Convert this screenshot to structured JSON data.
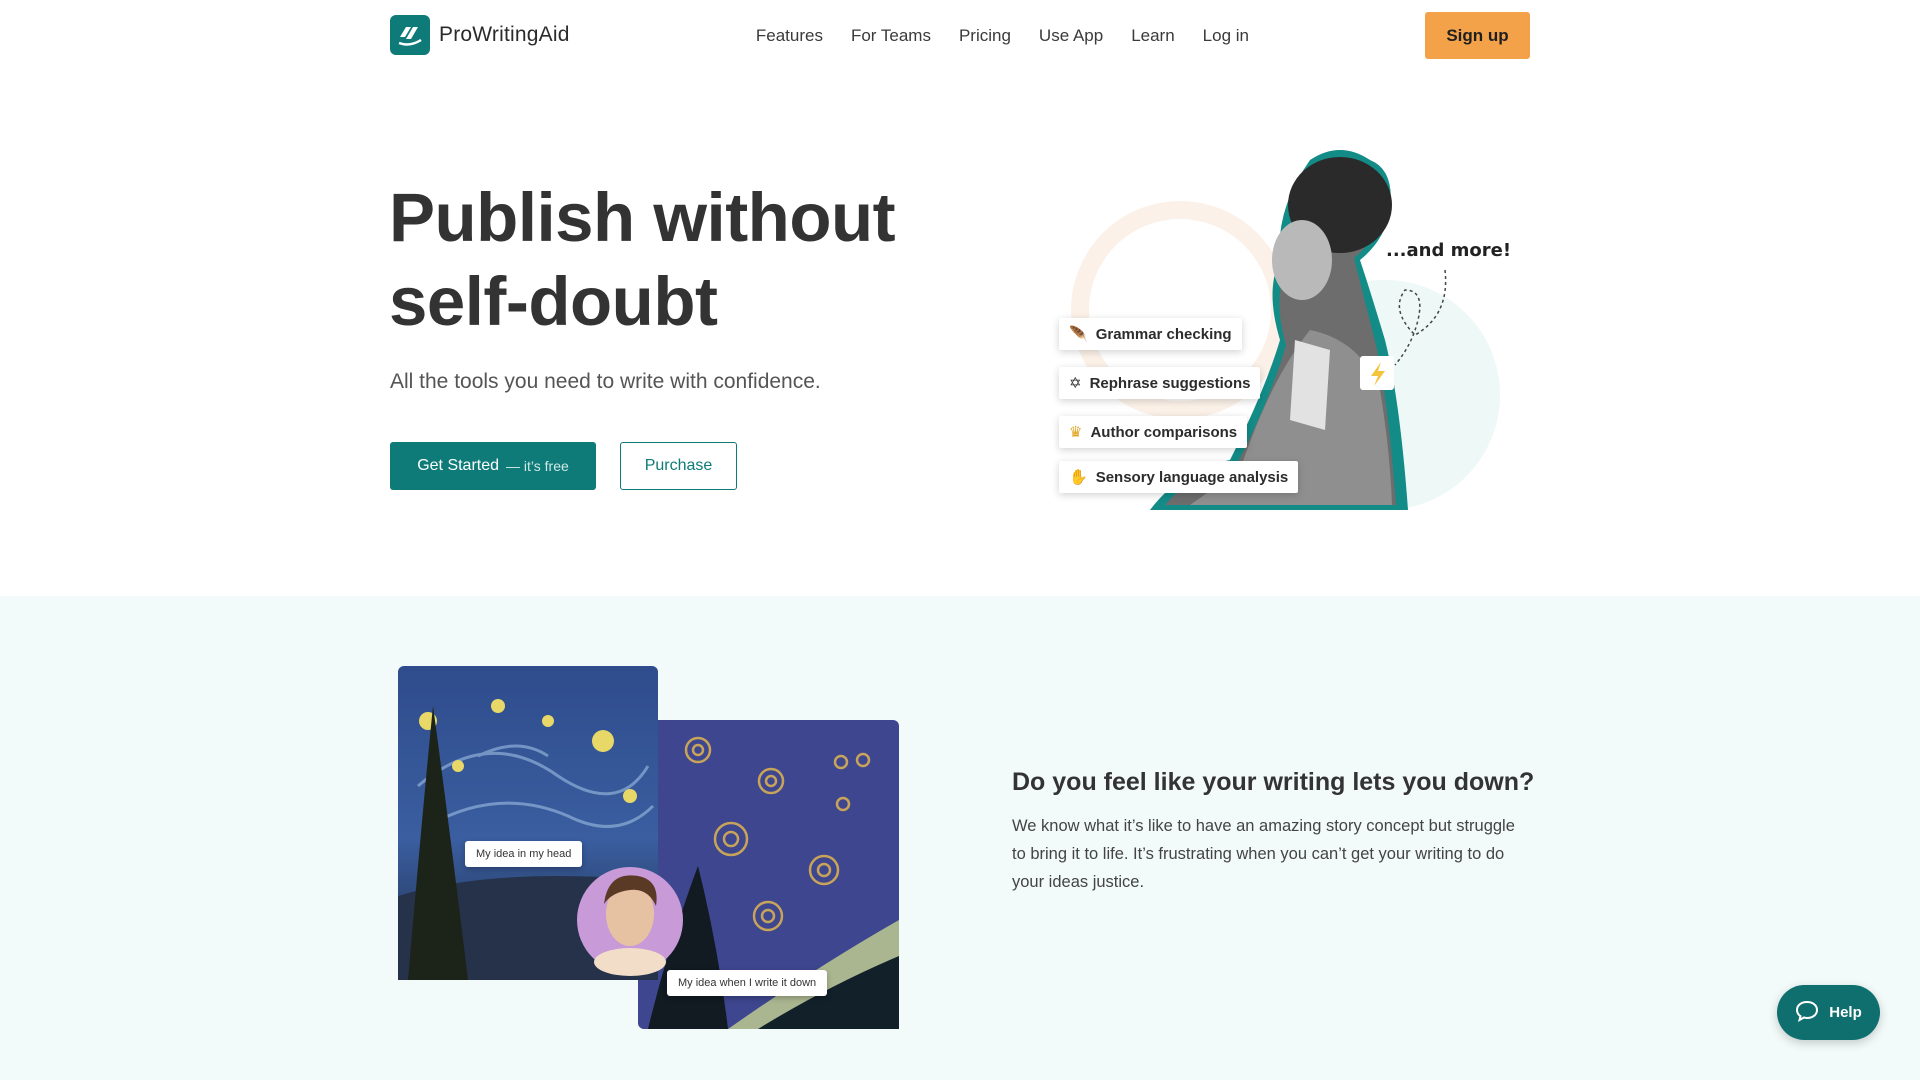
{
  "brand": {
    "name": "ProWritingAid",
    "accent": "#0e7b78",
    "signup_color": "#f4a249"
  },
  "nav": {
    "links": [
      "Features",
      "For Teams",
      "Pricing",
      "Use App",
      "Learn",
      "Log in"
    ],
    "signup": "Sign up"
  },
  "hero": {
    "title": "Publish without self-doubt",
    "subtitle": "All the tools you need to write with confidence.",
    "primary_button": {
      "label": "Get Started",
      "aside": "— it’s free"
    },
    "secondary_button": "Purchase",
    "features": [
      {
        "label": "Grammar checking",
        "icon": "feather-icon"
      },
      {
        "label": "Rephrase suggestions",
        "icon": "magic-wand-icon"
      },
      {
        "label": "Author comparisons",
        "icon": "crown-icon"
      },
      {
        "label": "Sensory language analysis",
        "icon": "hand-icon"
      }
    ],
    "and_more": "...and more!"
  },
  "section2": {
    "title": "Do you feel like your writing lets you down?",
    "body": "We know what it’s like to have an amazing story concept but struggle to bring it to life. It’s frustrating when you can’t get your writing to do your ideas justice.",
    "bubble_head": "My idea in my head",
    "bubble_written": "My idea when I write it down"
  },
  "help": {
    "label": "Help"
  }
}
